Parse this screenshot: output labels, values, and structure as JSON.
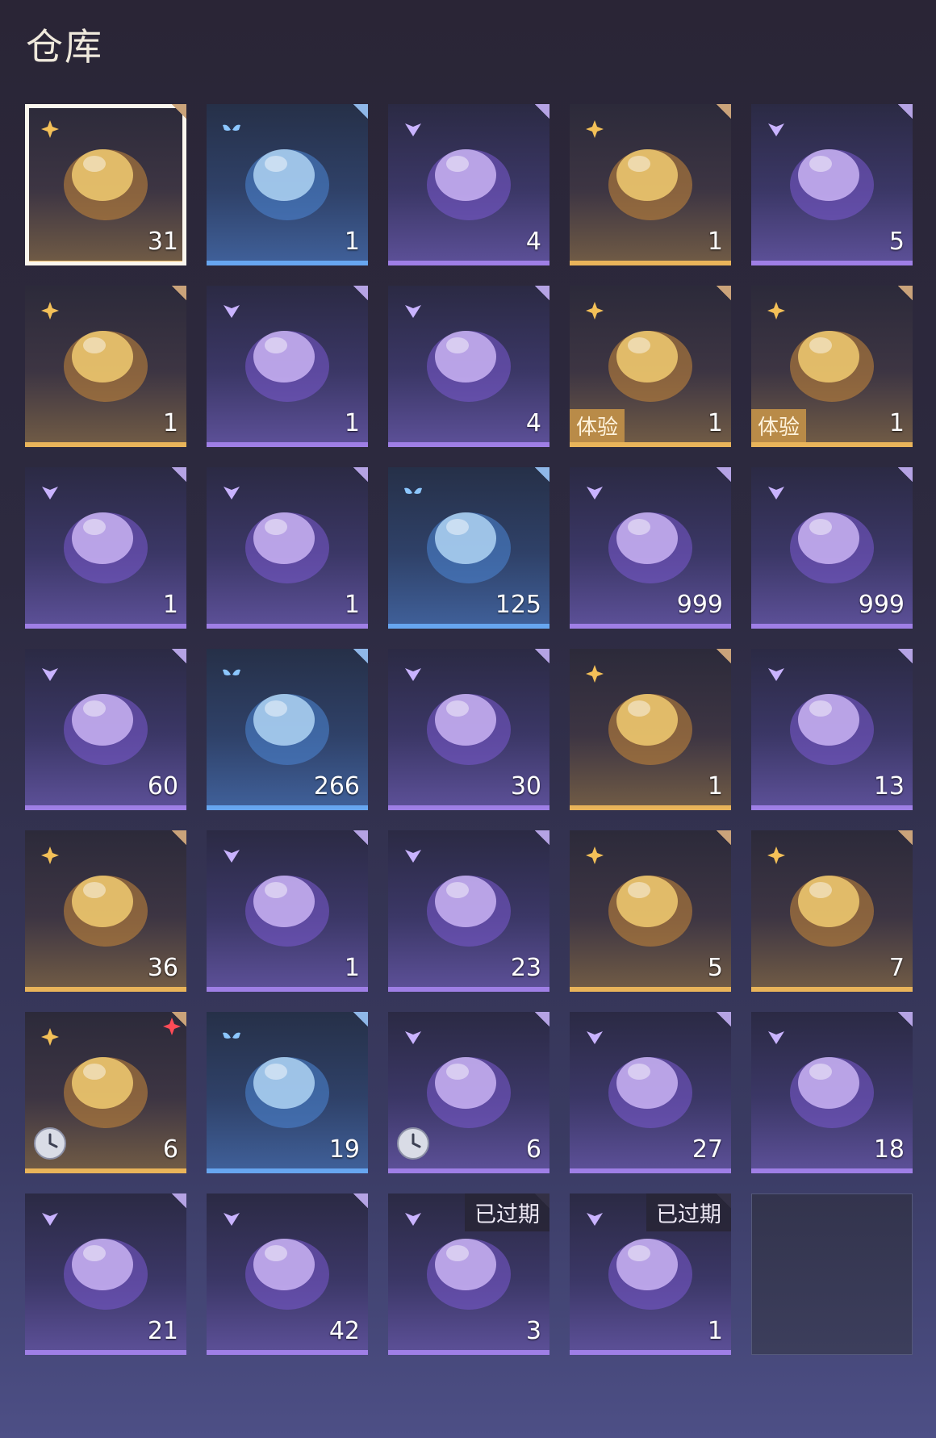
{
  "title": "仓库",
  "colors": {
    "orange": "#e9b45a",
    "purple": "#9f7fe6",
    "blue": "#67a6f0",
    "selected_outline": "#fbf6ee"
  },
  "items": [
    {
      "name": "crystal-icon",
      "quality": "orange",
      "count": "31",
      "selected": true
    },
    {
      "name": "jewel-box-icon",
      "quality": "blue",
      "count": "1"
    },
    {
      "name": "purple-gem-icon",
      "quality": "purple",
      "count": "4"
    },
    {
      "name": "gold-gem-icon",
      "quality": "orange",
      "count": "1"
    },
    {
      "name": "ember-stone-icon",
      "quality": "purple",
      "count": "5"
    },
    {
      "name": "ornate-dice-icon",
      "quality": "orange",
      "count": "1"
    },
    {
      "name": "gold-coin-icon",
      "quality": "purple",
      "count": "1"
    },
    {
      "name": "fire-hammer-icon",
      "quality": "purple",
      "count": "4"
    },
    {
      "name": "blue-costume-icon",
      "quality": "orange",
      "count": "1",
      "tag": "体验"
    },
    {
      "name": "dark-costume-icon",
      "quality": "orange",
      "count": "1",
      "tag": "体验"
    },
    {
      "name": "card-ticket-icon",
      "quality": "purple",
      "count": "1"
    },
    {
      "name": "lantern-icon",
      "quality": "purple",
      "count": "1"
    },
    {
      "name": "flame-emblem-icon",
      "quality": "blue",
      "count": "125"
    },
    {
      "name": "lotus-icon",
      "quality": "purple",
      "count": "999"
    },
    {
      "name": "lotus-icon",
      "quality": "purple",
      "count": "999"
    },
    {
      "name": "lotus-icon",
      "quality": "purple",
      "count": "60"
    },
    {
      "name": "powder-bowl-icon",
      "quality": "blue",
      "count": "266"
    },
    {
      "name": "tri-color-powder-icon",
      "quality": "purple",
      "count": "30"
    },
    {
      "name": "rainbow-powder-icon",
      "quality": "orange",
      "count": "1"
    },
    {
      "name": "puzzle-piece-icon",
      "quality": "purple",
      "count": "13"
    },
    {
      "name": "crystal-shell-icon",
      "quality": "orange",
      "count": "36"
    },
    {
      "name": "pouch-icon",
      "quality": "purple",
      "count": "1"
    },
    {
      "name": "jade-puzzle-icon",
      "quality": "purple",
      "count": "23"
    },
    {
      "name": "amulet-icon",
      "quality": "orange",
      "count": "5"
    },
    {
      "name": "firecracker-icon",
      "quality": "orange",
      "count": "7"
    },
    {
      "name": "golden-key-icon",
      "quality": "orange",
      "count": "6",
      "timed": true,
      "new": true
    },
    {
      "name": "orb-ring-icon",
      "quality": "blue",
      "count": "19"
    },
    {
      "name": "arrow-icon",
      "quality": "purple",
      "count": "6",
      "timed": true
    },
    {
      "name": "red-envelope-icon",
      "quality": "purple",
      "count": "27"
    },
    {
      "name": "jade-seal-icon",
      "quality": "purple",
      "count": "18"
    },
    {
      "name": "horn-icon",
      "quality": "purple",
      "count": "21"
    },
    {
      "name": "scroll-icon",
      "quality": "purple",
      "count": "42"
    },
    {
      "name": "mystery-toolbox-icon",
      "quality": "purple",
      "count": "3",
      "expired": "已过期"
    },
    {
      "name": "toolbox-icon",
      "quality": "purple",
      "count": "1",
      "expired": "已过期"
    },
    {
      "name": "empty-slot",
      "quality": "empty",
      "count": ""
    }
  ]
}
